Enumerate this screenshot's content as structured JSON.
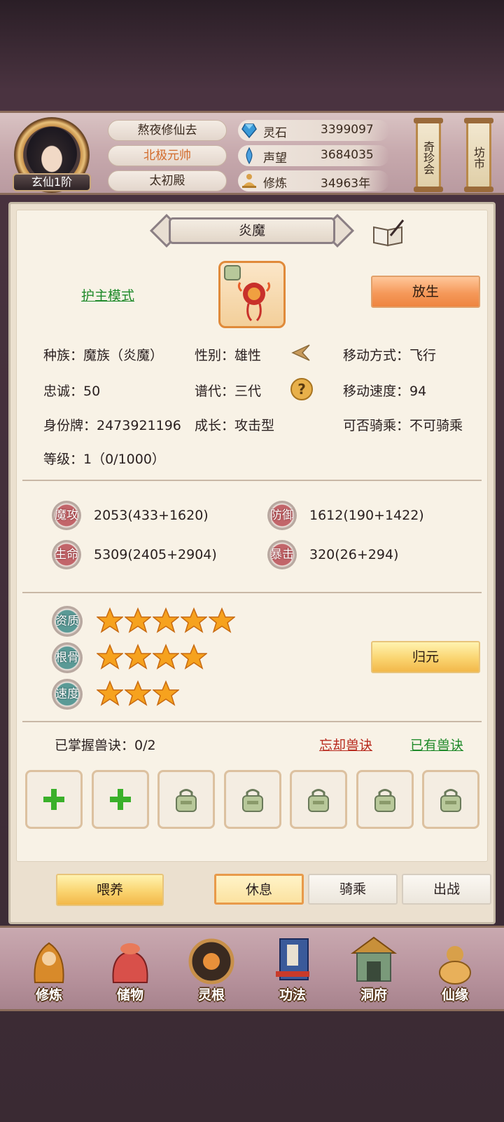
{
  "header": {
    "rank": "玄仙1阶",
    "names": [
      "熬夜修仙去",
      "北极元帅",
      "太初殿"
    ],
    "resources": [
      {
        "icon": "spirit-stone-icon",
        "label": "灵石",
        "value": "3399097"
      },
      {
        "icon": "prestige-icon",
        "label": "声望",
        "value": "3684035"
      },
      {
        "icon": "cultivation-icon",
        "label": "修炼",
        "value": "34963年"
      }
    ],
    "scroll_buttons": [
      "奇珍会",
      "坊市"
    ]
  },
  "pet": {
    "name": "炎魔",
    "mode_link": "护主模式",
    "release_button": "放生",
    "info": {
      "race": "种族：魔族（炎魔）",
      "gender": "性别：雄性",
      "move_type": "移动方式：飞行",
      "loyalty": "忠诚：50",
      "generation": "谱代：三代",
      "move_speed": "移动速度：94",
      "id_tag": "身份牌：2473921196",
      "growth": "成长：攻击型",
      "rideable": "可否骑乘：不可骑乘",
      "level": "等级：1（0/1000）"
    },
    "stats": [
      {
        "icon": "魔攻",
        "value": "2053(433+1620)"
      },
      {
        "icon": "防御",
        "value": "1612(190+1422)"
      },
      {
        "icon": "生命",
        "value": "5309(2405+2904)"
      },
      {
        "icon": "暴击",
        "value": "320(26+294)"
      }
    ],
    "aptitudes": [
      {
        "icon": "资质",
        "stars": 5
      },
      {
        "icon": "根骨",
        "stars": 4
      },
      {
        "icon": "速度",
        "stars": 3
      }
    ],
    "reset_button": "归元",
    "skills": {
      "mastered": "已掌握兽诀：0/2",
      "forget_link": "忘却兽诀",
      "owned_link": "已有兽诀",
      "slots": [
        "add",
        "add",
        "locked",
        "locked",
        "locked",
        "locked",
        "locked"
      ]
    }
  },
  "actions": {
    "feed": "喂养",
    "tabs": [
      "休息",
      "骑乘",
      "出战"
    ],
    "active_tab": 0
  },
  "nav": [
    {
      "icon": "cultivate-icon",
      "label": "修炼"
    },
    {
      "icon": "storage-bag-icon",
      "label": "储物"
    },
    {
      "icon": "spirit-root-icon",
      "label": "灵根"
    },
    {
      "icon": "technique-book-icon",
      "label": "功法"
    },
    {
      "icon": "cave-mansion-icon",
      "label": "洞府"
    },
    {
      "icon": "immortal-fate-icon",
      "label": "仙缘"
    }
  ],
  "colors": {
    "accent_orange": "#f5995a",
    "link_green": "#1f8a2a",
    "link_red": "#b82a1e",
    "panel_bg": "#f8f2e6"
  }
}
